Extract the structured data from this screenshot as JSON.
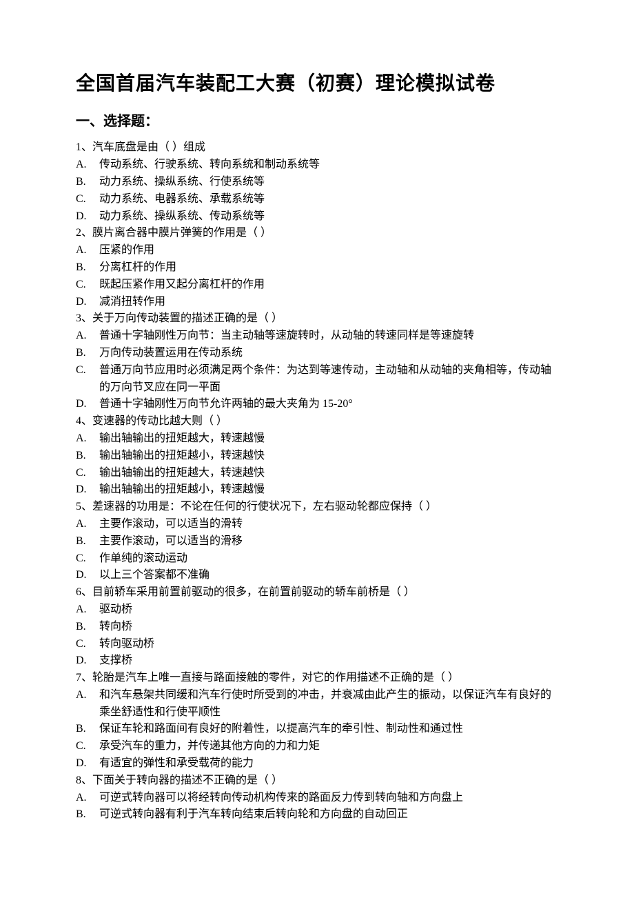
{
  "title": "全国首届汽车装配工大赛（初赛）理论模拟试卷",
  "section1_title": "一、选择题：",
  "questions": [
    {
      "stem": "1、汽车底盘是由（   ）组成",
      "options": [
        {
          "letter": "A.",
          "text": "传动系统、行驶系统、转向系统和制动系统等"
        },
        {
          "letter": "B.",
          "text": "动力系统、操纵系统、行使系统等"
        },
        {
          "letter": "C.",
          "text": "动力系统、电器系统、承载系统等"
        },
        {
          "letter": "D.",
          "text": "动力系统、操纵系统、传动系统等"
        }
      ]
    },
    {
      "stem": "2、膜片离合器中膜片弹簧的作用是（   ）",
      "options": [
        {
          "letter": "A.",
          "text": "压紧的作用"
        },
        {
          "letter": "B.",
          "text": "分离杠杆的作用"
        },
        {
          "letter": "C.",
          "text": "既起压紧作用又起分离杠杆的作用"
        },
        {
          "letter": "D.",
          "text": "减消扭转作用"
        }
      ]
    },
    {
      "stem": "3、关于万向传动装置的描述正确的是（   ）",
      "options": [
        {
          "letter": "A.",
          "text": "普通十字轴刚性万向节：当主动轴等速旋转时，从动轴的转速同样是等速旋转"
        },
        {
          "letter": "B.",
          "text": "万向传动装置运用在传动系统"
        },
        {
          "letter": "C.",
          "text": "普通万向节应用时必须满足两个条件：为达到等速传动，主动轴和从动轴的夹角相等，传动轴的万向节叉应在同一平面"
        },
        {
          "letter": "D.",
          "text": "普通十字轴刚性万向节允许两轴的最大夹角为 15-20°"
        }
      ]
    },
    {
      "stem": "4、变速器的传动比越大则（   ）",
      "options": [
        {
          "letter": "A.",
          "text": "输出轴输出的扭矩越大，转速越慢"
        },
        {
          "letter": "B.",
          "text": "输出轴输出的扭矩越小，转速越快"
        },
        {
          "letter": "C.",
          "text": "输出轴输出的扭矩越大，转速越快"
        },
        {
          "letter": "D.",
          "text": "输出轴输出的扭矩越小，转速越慢"
        }
      ]
    },
    {
      "stem": "5、差速器的功用是：不论在任何的行使状况下，左右驱动轮都应保持（   ）",
      "options": [
        {
          "letter": "A.",
          "text": "主要作滚动，可以适当的滑转"
        },
        {
          "letter": "B.",
          "text": "主要作滚动，可以适当的滑移"
        },
        {
          "letter": "C.",
          "text": "作单纯的滚动运动"
        },
        {
          "letter": "D.",
          "text": "以上三个答案都不准确"
        }
      ]
    },
    {
      "stem": "6、目前轿车采用前置前驱动的很多，在前置前驱动的轿车前桥是（   ）",
      "options": [
        {
          "letter": "A.",
          "text": "驱动桥"
        },
        {
          "letter": "B.",
          "text": "转向桥"
        },
        {
          "letter": "C.",
          "text": "转向驱动桥"
        },
        {
          "letter": "D.",
          "text": "支撑桥"
        }
      ]
    },
    {
      "stem": "7、轮胎是汽车上唯一直接与路面接触的零件，对它的作用描述不正确的是（   ）",
      "options": [
        {
          "letter": "A.",
          "text": "和汽车悬架共同缓和汽车行使时所受到的冲击，并衰减由此产生的振动，以保证汽车有良好的乘坐舒适性和行使平顺性"
        },
        {
          "letter": "B.",
          "text": "保证车轮和路面间有良好的附着性，以提高汽车的牵引性、制动性和通过性"
        },
        {
          "letter": "C.",
          "text": "承受汽车的重力，并传递其他方向的力和力矩"
        },
        {
          "letter": "D.",
          "text": "有适宜的弹性和承受载荷的能力"
        }
      ]
    },
    {
      "stem": "8、下面关于转向器的描述不正确的是（   ）",
      "options": [
        {
          "letter": "A.",
          "text": "可逆式转向器可以将经转向传动机构传来的路面反力传到转向轴和方向盘上"
        },
        {
          "letter": "B.",
          "text": "可逆式转向器有利于汽车转向结束后转向轮和方向盘的自动回正"
        }
      ]
    }
  ]
}
